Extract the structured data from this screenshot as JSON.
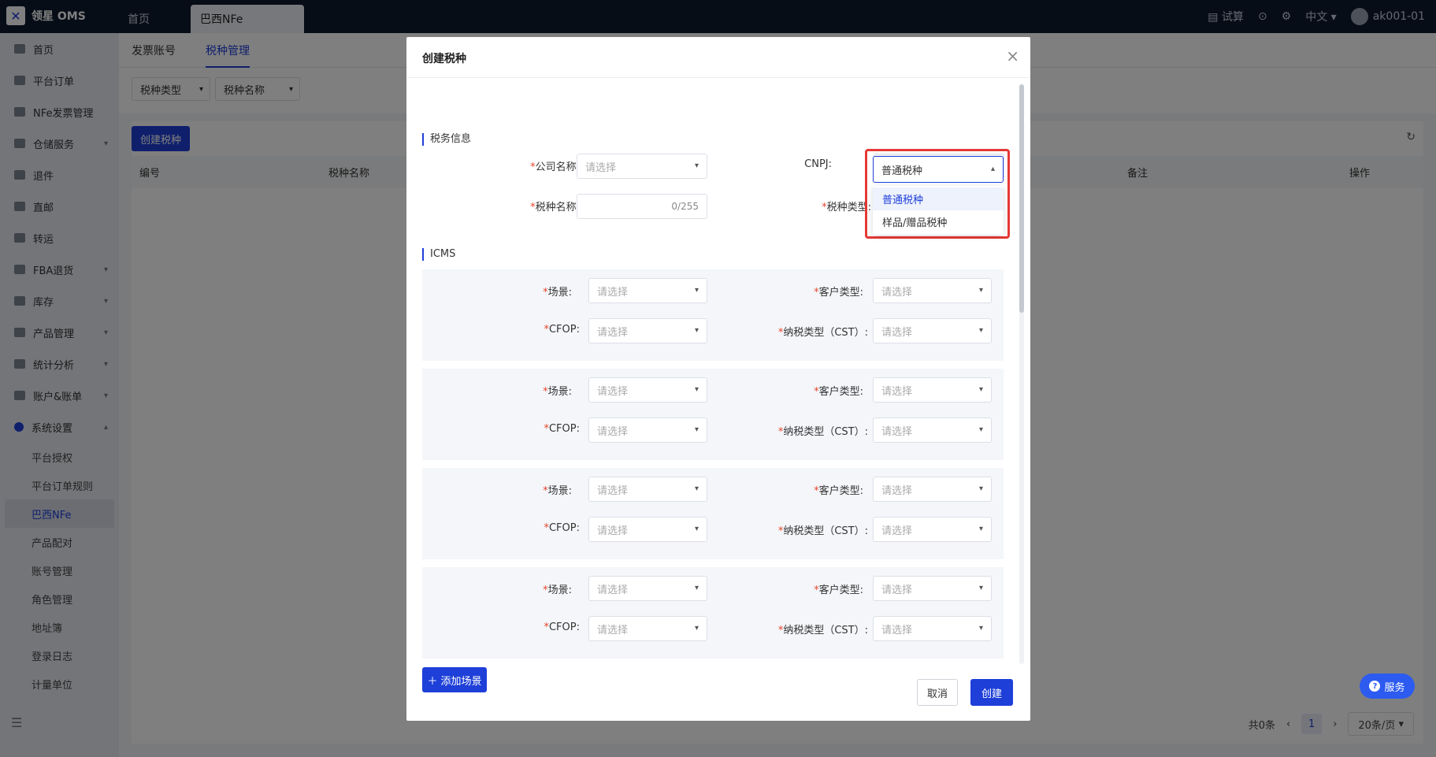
{
  "app": {
    "logo_text": "领星 OMS"
  },
  "top_tabs": [
    {
      "label": "首页"
    },
    {
      "label": "巴西NFe"
    }
  ],
  "top_right": {
    "trial": "试算",
    "language": "中文",
    "user": "ak001-01"
  },
  "sidebar": {
    "items": [
      {
        "label": "首页"
      },
      {
        "label": "平台订单"
      },
      {
        "label": "NFe发票管理"
      },
      {
        "label": "仓储服务"
      },
      {
        "label": "退件"
      },
      {
        "label": "直邮"
      },
      {
        "label": "转运"
      },
      {
        "label": "FBA退货"
      },
      {
        "label": "库存"
      },
      {
        "label": "产品管理"
      },
      {
        "label": "统计分析"
      },
      {
        "label": "账户&账单"
      },
      {
        "label": "系统设置"
      }
    ],
    "sub_items": [
      {
        "label": "平台授权"
      },
      {
        "label": "平台订单规则"
      },
      {
        "label": "巴西NFe"
      },
      {
        "label": "产品配对"
      },
      {
        "label": "账号管理"
      },
      {
        "label": "角色管理"
      },
      {
        "label": "地址簿"
      },
      {
        "label": "登录日志"
      },
      {
        "label": "计量单位"
      }
    ]
  },
  "page": {
    "subtabs": [
      {
        "label": "发票账号"
      },
      {
        "label": "税种管理"
      }
    ],
    "filters": [
      {
        "label": "税种类型"
      },
      {
        "label": "税种名称"
      }
    ],
    "create_button": "创建税种",
    "table_headers": [
      "编号",
      "税种名称",
      "备注",
      "操作"
    ],
    "pager": {
      "total": "共0条",
      "current_page": "1",
      "page_size": "20条/页"
    }
  },
  "modal": {
    "title": "创建税种",
    "section_tax": "税务信息",
    "section_icms": "ICMS",
    "company_label": "公司名称:",
    "company_placeholder": "请选择",
    "cnpj_label": "CNPJ:",
    "tax_name_label": "税种名称:",
    "tax_name_counter": "0/255",
    "tax_type_label": "税种类型:",
    "tax_type_value": "普通税种",
    "tax_type_options": [
      "普通税种",
      "样品/赠品税种"
    ],
    "scene_label": "场景:",
    "customer_type_label": "客户类型:",
    "cfop_label": "CFOP:",
    "cst_label": "纳税类型（CST）:",
    "placeholder": "请选择",
    "add_scene_button": "添加场景",
    "cancel_button": "取消",
    "create_button": "创建"
  },
  "service_button": "服务"
}
